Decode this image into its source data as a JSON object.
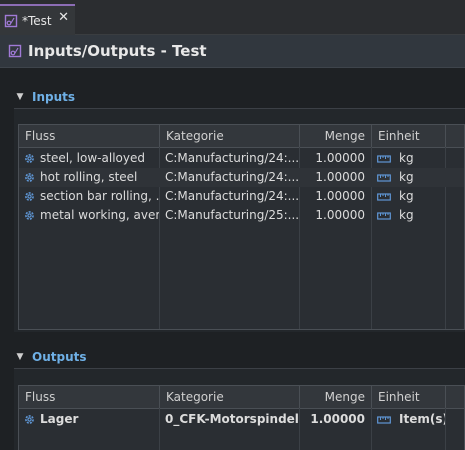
{
  "tab": {
    "title": "*Test"
  },
  "editor": {
    "title": "Inputs/Outputs - Test"
  },
  "inputs": {
    "label": "Inputs",
    "columns": [
      "Fluss",
      "Kategorie",
      "Menge",
      "Einheit"
    ],
    "rows": [
      {
        "flow": "steel, low-alloyed",
        "category": "C:Manufacturing/24:...",
        "amount": "1.00000",
        "unit": "kg"
      },
      {
        "flow": "hot rolling, steel",
        "category": "C:Manufacturing/24:...",
        "amount": "1.00000",
        "unit": "kg"
      },
      {
        "flow": "section bar rolling, ...",
        "category": "C:Manufacturing/24:...",
        "amount": "1.00000",
        "unit": "kg"
      },
      {
        "flow": "metal working, aver...",
        "category": "C:Manufacturing/25:...",
        "amount": "1.00000",
        "unit": "kg"
      }
    ]
  },
  "outputs": {
    "label": "Outputs",
    "columns": [
      "Fluss",
      "Kategorie",
      "Menge",
      "Einheit"
    ],
    "rows": [
      {
        "flow": "Lager",
        "category": "0_CFK-Motorspindel",
        "amount": "1.00000",
        "unit": "Item(s)"
      }
    ]
  },
  "colors": {
    "accent": "#6fb0e6",
    "tab_accent": "#8c6db5",
    "flow_icon": "#5f97d6"
  },
  "icons": {
    "tab": "process-icon",
    "flow": "gear-icon",
    "unit": "ruler-icon"
  }
}
